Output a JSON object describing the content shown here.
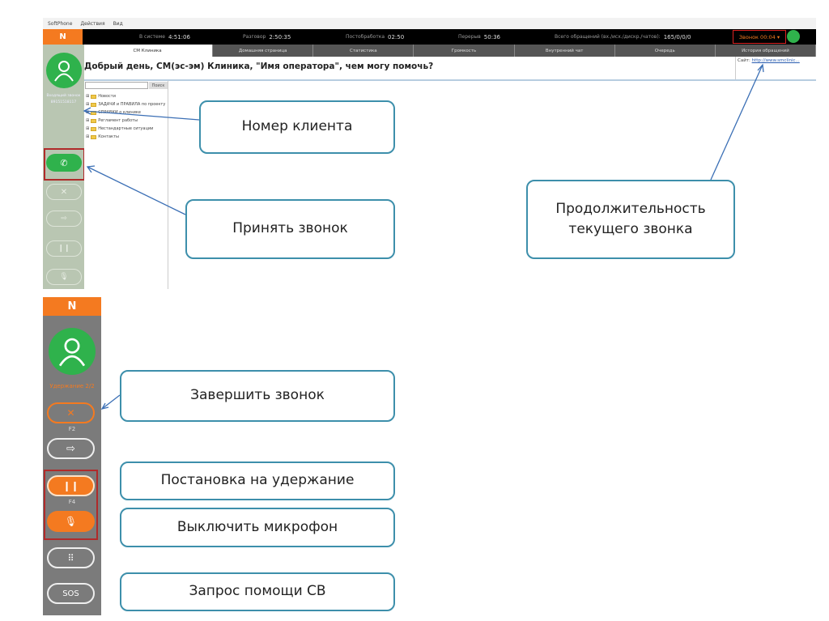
{
  "app": {
    "menu": [
      "SoftPhone",
      "Действия",
      "Вид"
    ],
    "logo": "N"
  },
  "stats": {
    "in_system_label": "В системе",
    "in_system": "4:51:06",
    "talk_label": "Разговор",
    "talk": "2:50:35",
    "post_label": "Постобработка",
    "post": "02:50",
    "break_label": "Перерыв",
    "break": "50:36",
    "total_label": "Всего обращений (вх./исх./дискр./чатов):",
    "total": "165/0/0/0",
    "call": "Звонок 00:04 ▾"
  },
  "tabs": [
    "СМ Клиника",
    "Домашняя страница",
    "Статистика",
    "Громкость",
    "Внутренний чат",
    "Очередь",
    "История обращений"
  ],
  "greeting": "Добрый день, СМ(эс-эм) Клиника, \"Имя оператора\", чем могу помочь?",
  "site": {
    "label": "Сайт:",
    "url": "http://www.smclinic..."
  },
  "search_button": "Поиск",
  "tree": [
    "Новости",
    "ЗАДАЧИ и ПРАВИЛА по проекту",
    "СПРАВКИ о клинике",
    "Регламент работы",
    "Нестандартные ситуации",
    "Контакты"
  ],
  "sidebar_top": {
    "status": "Входящий звонок",
    "number": "89151518117"
  },
  "sidebar_bottom": {
    "status": "Удержание 2/2",
    "f2": "F2",
    "f4": "F4",
    "sos": "SOS"
  },
  "callouts": {
    "client_number": "Номер клиента",
    "accept": "Принять звонок",
    "duration": "Продолжительность текущего звонка",
    "end": "Завершить звонок",
    "hold": "Постановка на удержание",
    "mute": "Выключить микрофон",
    "help": "Запрос помощи СВ"
  },
  "colors": {
    "accent": "#f47a20",
    "green": "#2fb24c",
    "callout_border": "#3d8fab"
  }
}
